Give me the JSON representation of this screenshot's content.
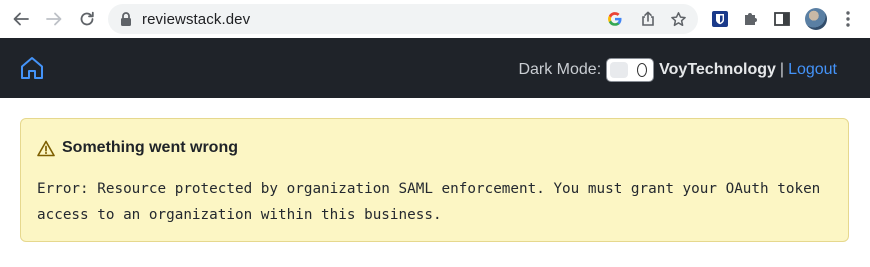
{
  "browser": {
    "url": "reviewstack.dev",
    "icons": {
      "back": "arrow-left-icon",
      "forward": "arrow-right-icon",
      "reload": "reload-icon",
      "lock": "lock-icon",
      "google": "google-icon",
      "share": "share-icon",
      "bookmark": "star-icon",
      "extension_app": "bitwarden-icon",
      "extensions": "puzzle-icon",
      "sidebar": "sidebar-icon",
      "profile": "avatar",
      "menu": "kebab-menu-icon"
    }
  },
  "navbar": {
    "home_icon": "home-icon",
    "dark_mode_label": "Dark Mode:",
    "toggle_state": "off",
    "organization": "VoyTechnology",
    "separator": "|",
    "logout_label": "Logout"
  },
  "flash": {
    "icon": "alert-icon",
    "title": "Something went wrong",
    "message": "Error: Resource protected by organization SAML enforcement. You must grant your OAuth token access to an organization within this business."
  },
  "colors": {
    "navbar_bg": "#1f2329",
    "link": "#4493f8",
    "flash_bg": "#fcf6c4",
    "flash_border": "#e6d88e"
  }
}
